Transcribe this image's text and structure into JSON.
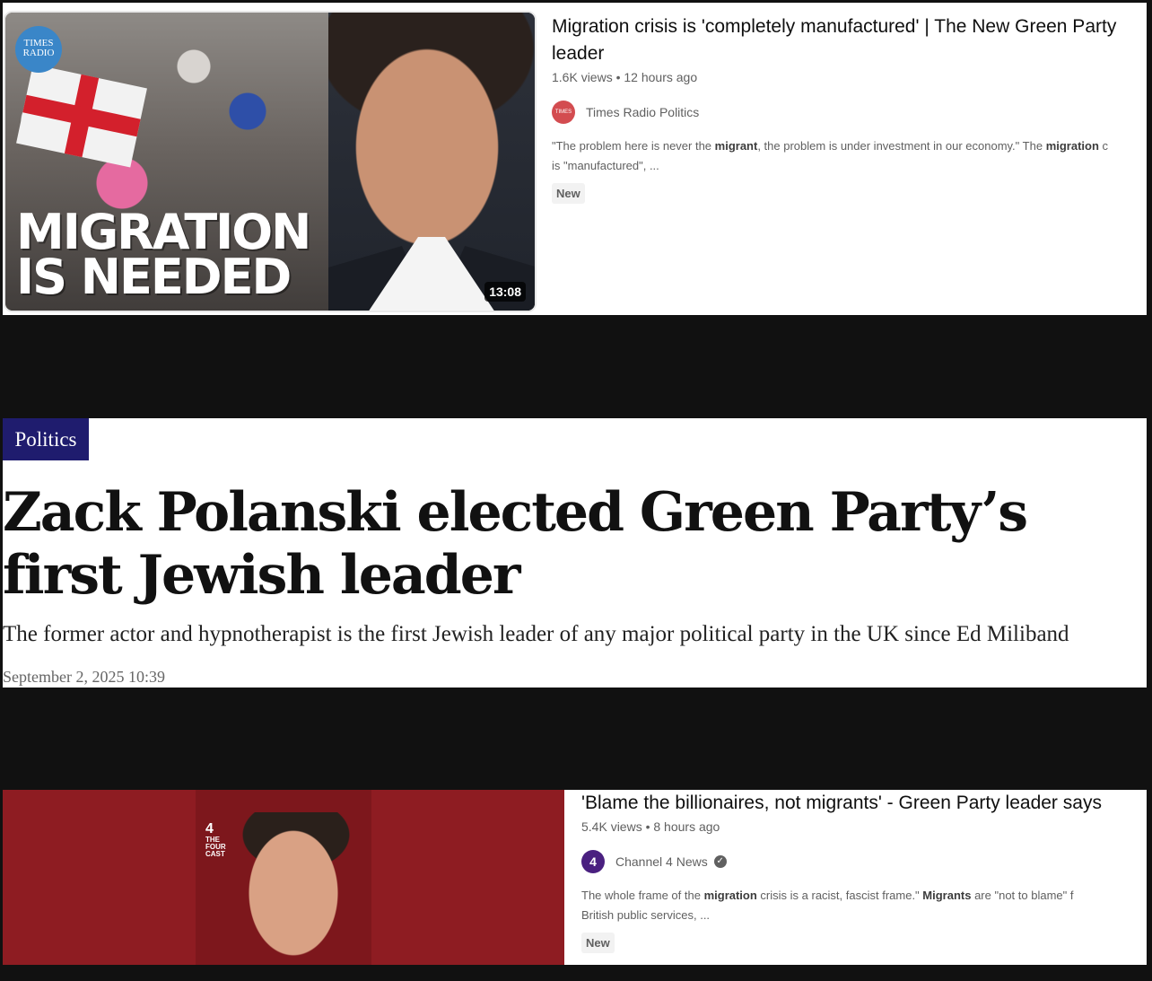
{
  "video1": {
    "title": "Migration crisis is 'completely manufactured' | The New Green Party leader",
    "meta": "1.6K views • 12 hours ago",
    "channel": "Times Radio Politics",
    "snippet_parts": [
      "\"The problem here is never the ",
      "migrant",
      ", the problem is under investment in our economy.\" The ",
      "migration",
      " c"
    ],
    "snippet_line2": "is \"manufactured\", ...",
    "badge": "New",
    "thumb_logo": "TIMES RADIO",
    "thumb_headline_line1": "MIGRATION",
    "thumb_headline_line2": "IS NEEDED",
    "duration": "13:08"
  },
  "article": {
    "section": "Politics",
    "headline": "Zack Polanski elected Green Party’s first Jewish leader",
    "standfirst": "The former actor and hypnotherapist is the first Jewish leader of any major political party in the UK since Ed Miliband",
    "dateline": "September 2, 2025 10:39"
  },
  "video3": {
    "title": "'Blame the billionaires, not migrants' - Green Party leader says",
    "meta": "5.4K views • 8 hours ago",
    "channel": "Channel 4 News",
    "snippet_parts": [
      "The whole frame of the ",
      "migration",
      " crisis is a racist, fascist frame.\" ",
      "Migrants",
      " are \"not to blame\" f"
    ],
    "snippet_line2": "British public services, ...",
    "badge": "New",
    "thumb_logo_number": "4",
    "thumb_logo_text": "THE FOUR CAST"
  },
  "colors": {
    "page_background": "#111111",
    "politics_tag": "#1f1c6e",
    "channel4_purple": "#4a2080",
    "times_radio_blue": "#3a86c8",
    "thumb3_red": "#8e1c22"
  }
}
